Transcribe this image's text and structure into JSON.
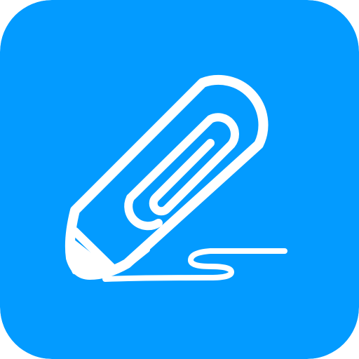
{
  "app_icon": {
    "icon": "pencil-paperclip-signature-icon",
    "background_color": "#039BFF",
    "foreground_color": "#FFFFFF"
  }
}
